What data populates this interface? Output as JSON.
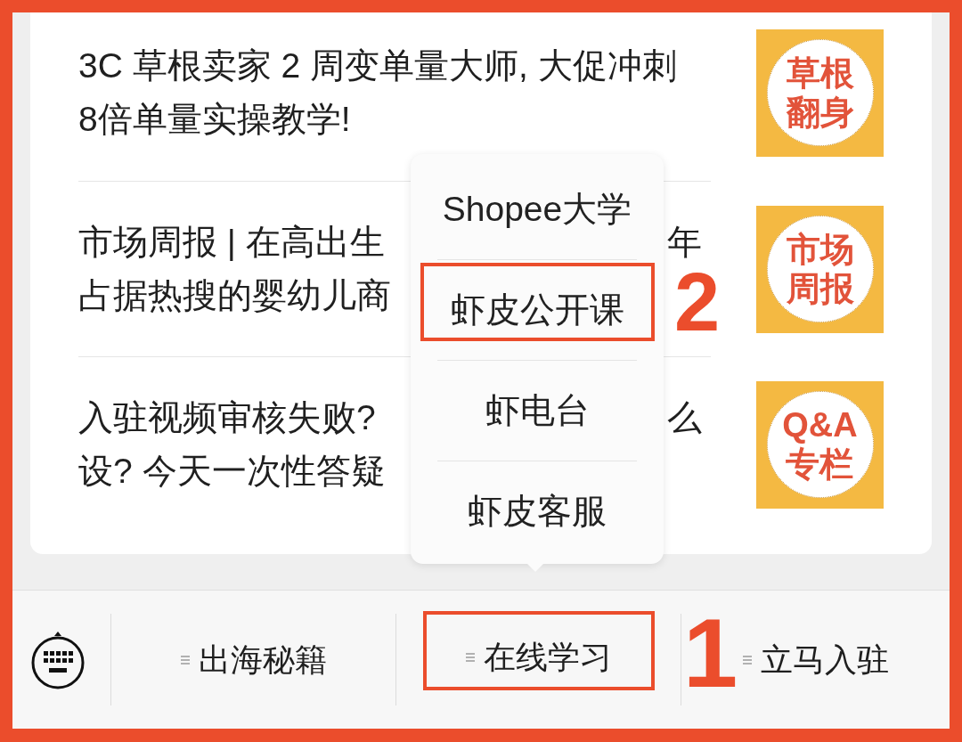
{
  "articles": [
    {
      "title_lines": [
        "3C 草根卖家 2 周变单量大师, 大促冲刺",
        "8倍单量实操教学!"
      ],
      "thumbnail_lines": [
        "草根",
        "翻身"
      ]
    },
    {
      "title_lines": [
        "市场周报 | 在高出生",
        "占据热搜的婴幼儿商"
      ],
      "title_tail": "年",
      "thumbnail_lines": [
        "市场",
        "周报"
      ]
    },
    {
      "title_lines": [
        "入驻视频审核失败?",
        "设? 今天一次性答疑"
      ],
      "title_tail": "么",
      "thumbnail_lines": [
        "Q&A",
        "专栏"
      ]
    }
  ],
  "popup_menu": {
    "items": [
      {
        "label": "Shopee大学",
        "highlighted": false
      },
      {
        "label": "虾皮公开课",
        "highlighted": true,
        "callout": "2"
      },
      {
        "label": "虾电台",
        "highlighted": false
      },
      {
        "label": "虾皮客服",
        "highlighted": false
      }
    ]
  },
  "bottom_bar": {
    "tabs": [
      {
        "label": "出海秘籍",
        "highlighted": false
      },
      {
        "label": "在线学习",
        "highlighted": true,
        "callout": "1"
      },
      {
        "label": "立马入驻",
        "highlighted": false
      }
    ]
  }
}
